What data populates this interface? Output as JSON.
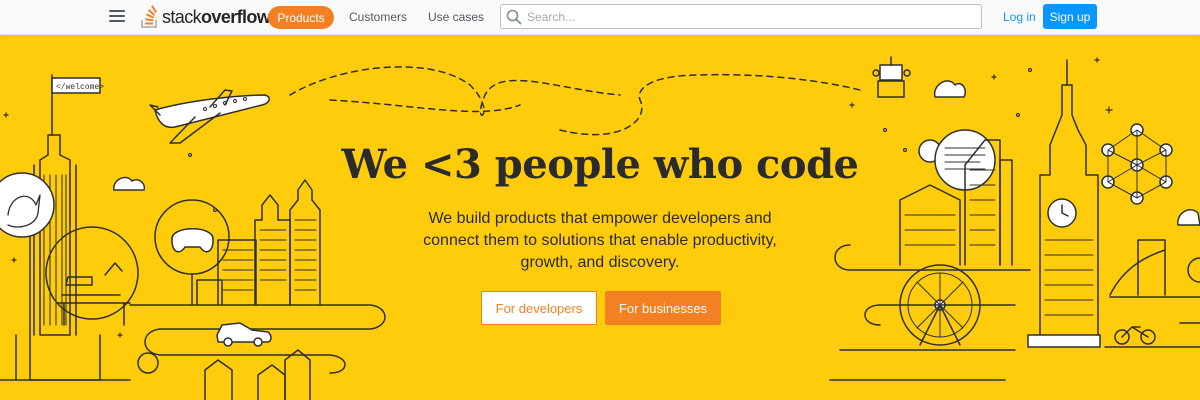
{
  "topbar": {
    "logo_text_light": "stack",
    "logo_text_bold": "overflow",
    "nav": {
      "products": "Products",
      "customers": "Customers",
      "use_cases": "Use cases"
    },
    "search": {
      "placeholder": "Search..."
    },
    "login": "Log in",
    "signup": "Sign up",
    "colors": {
      "products_pill": "#f48024",
      "signup": "#0a95ff",
      "login": "#0a95ff"
    }
  },
  "hero": {
    "title": "We <3 people who code",
    "subtitle": "We build products that empower developers and connect them to solutions that enable productivity, growth, and discovery.",
    "btn_developers": "For developers",
    "btn_businesses": "For businesses",
    "flag_sign": "</welcome>",
    "background": "#ffcc0b",
    "accent": "#f48024"
  },
  "icons": [
    "menu-icon",
    "stackoverflow-logo-icon",
    "search-icon"
  ]
}
